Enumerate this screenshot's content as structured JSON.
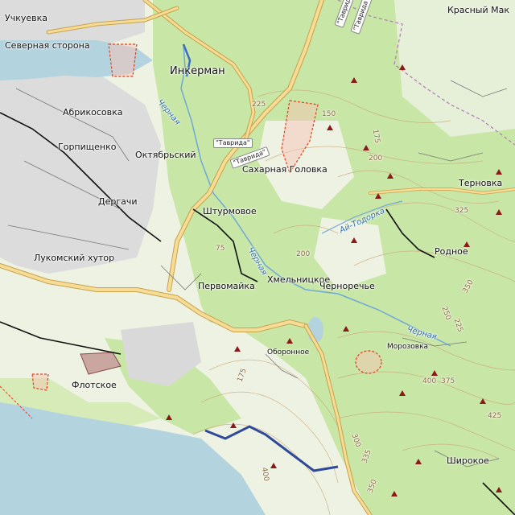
{
  "colors": {
    "sea": "#b3d3df",
    "forest": "#c8e6a5",
    "meadow": "#dfeecb",
    "urban": "#dcdcdc",
    "trunk_road": "#f6dc96",
    "road_casing": "#c9a24a",
    "railway": "#111111",
    "boundary": "#b07ab5",
    "river": "#6fa8d6",
    "contour": "#c9a77a",
    "peak": "#8b1a1a",
    "restricted": "#e0401e",
    "route": "#2f4a9a"
  },
  "places": {
    "uchkuevka": "Учкуевка",
    "severnaya": "Северная сторона",
    "krasny_mak": "Красный Мак",
    "inkerman": "Инкерман",
    "abrikosovka": "Абрикосовка",
    "gorpishchenko": "Горпищенко",
    "oktyabrsky": "Октябрьский",
    "sakharnaya": "Сахарная Головка",
    "ternovka": "Терновка",
    "dergachi": "Дергачи",
    "shturmovoe": "Штурмовое",
    "rodnoe": "Родное",
    "lukomsky": "Лукомский хутор",
    "pervomayka": "Первомайка",
    "khmelnitskoe": "Хмельницкое",
    "chernorechye": "Черноречье",
    "oboronnoe": "Оборонное",
    "morozovka": "Морозовка",
    "flotskoe": "Флотское",
    "shirokoe": "Широкое"
  },
  "roads": {
    "tavrida_1": "\"Таврида\"",
    "tavrida_2": "\"Таврида\"",
    "tavrida_3": "\"Таврида\"",
    "tavrida_4": "\"Таврида\""
  },
  "water": {
    "chernaya_1": "Черная",
    "chernaya_2": "Черная",
    "ai_todorka": "Ай-Тодорка",
    "chernaya_3": "Черная"
  },
  "contours": [
    "225",
    "150",
    "175",
    "200",
    "325",
    "75",
    "200",
    "350",
    "250",
    "225",
    "400",
    "375",
    "425",
    "175",
    "400",
    "300",
    "335",
    "350"
  ]
}
